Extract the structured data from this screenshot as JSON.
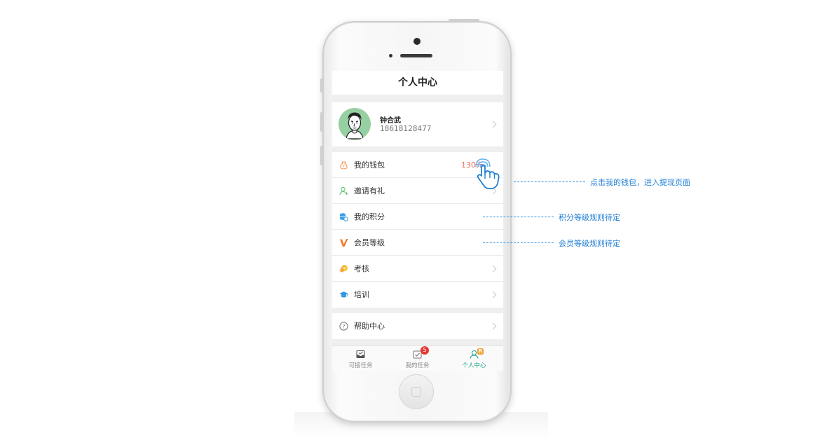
{
  "screen": {
    "header_title": "个人中心"
  },
  "profile": {
    "name": "钟合武",
    "phone": "18618128477"
  },
  "menu_group_1": [
    {
      "label": "我的钱包",
      "value": "130元",
      "icon": "wallet-icon",
      "icon_color": "#f39b5a"
    },
    {
      "label": "邀请有礼",
      "icon": "invite-user-icon",
      "icon_color": "#5cc569"
    },
    {
      "label": "我的积分",
      "icon": "points-coins-icon",
      "icon_color": "#3a9ee8"
    },
    {
      "label": "会员等级",
      "icon": "vip-v-icon",
      "icon_color": "#f07d2c"
    },
    {
      "label": "考核",
      "icon": "assessment-icon",
      "icon_color": "#f6c035"
    },
    {
      "label": "培训",
      "icon": "graduation-cap-icon",
      "icon_color": "#2f95e2"
    }
  ],
  "menu_group_2": [
    {
      "label": "帮助中心",
      "icon": "help-circle-icon",
      "icon_color": "#777777"
    }
  ],
  "tabbar": [
    {
      "label": "可接任务",
      "icon": "task-inbox-icon"
    },
    {
      "label": "我的任务",
      "icon": "task-check-icon",
      "badge": "5"
    },
    {
      "label": "个人中心",
      "icon": "person-icon",
      "badge": "R",
      "active": true
    }
  ],
  "annotations": {
    "wallet_note": "点击我的钱包，进入提现页面",
    "points_note": "积分等级规则待定",
    "vip_note": "会员等级规则待定"
  },
  "colors": {
    "accent": "#1aa38b",
    "annotation": "#1f7fd6",
    "wallet_value": "#f06d5b",
    "badge_red": "#e53935",
    "badge_orange": "#f2a33a"
  }
}
